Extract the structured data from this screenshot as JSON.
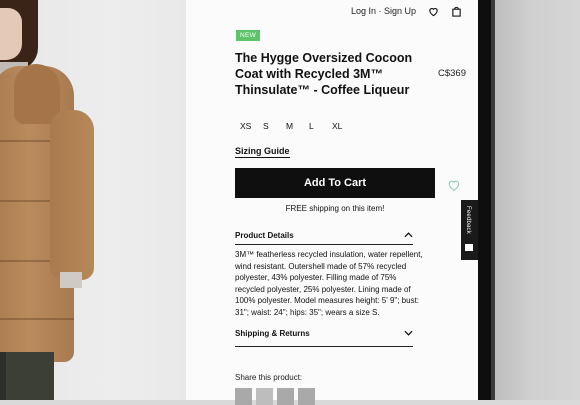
{
  "nav": {
    "login_label": "Log In · Sign Up"
  },
  "product": {
    "badge": "NEW",
    "title": "The Hygge Oversized Cocoon Coat with Recycled 3M™ Thinsulate™ - Coffee Liqueur",
    "price": "C$369",
    "sizes": [
      "XS",
      "S",
      "M",
      "L",
      "XL"
    ],
    "sizing_guide_label": "Sizing Guide",
    "add_to_cart_label": "Add To Cart",
    "shipping_note": "FREE shipping on this item!"
  },
  "sections": {
    "details_title": "Product Details",
    "details_text": "3M™ featherless recycled insulation, water repellent, wind resistant. Outershell made of 57% recycled polyester, 43% polyester. Filling made of 75% recycled polyester, 25% polyester. Lining made of 100% polyester. Model measures height: 5' 9\"; bust: 31\"; waist: 24\"; hips: 35\"; wears a size S.",
    "shipping_title": "Shipping & Returns"
  },
  "share": {
    "label": "Share this product:"
  },
  "feedback": {
    "label": "Feedback"
  },
  "colors": {
    "badge": "#5fc36a",
    "button": "#0f0f0f",
    "wishlist": "#8fc9b5"
  },
  "icons": [
    "heart-icon",
    "shopping-bag-icon",
    "wishlist-heart-icon",
    "chevron-up-icon",
    "chevron-down-icon",
    "feedback-icon"
  ]
}
